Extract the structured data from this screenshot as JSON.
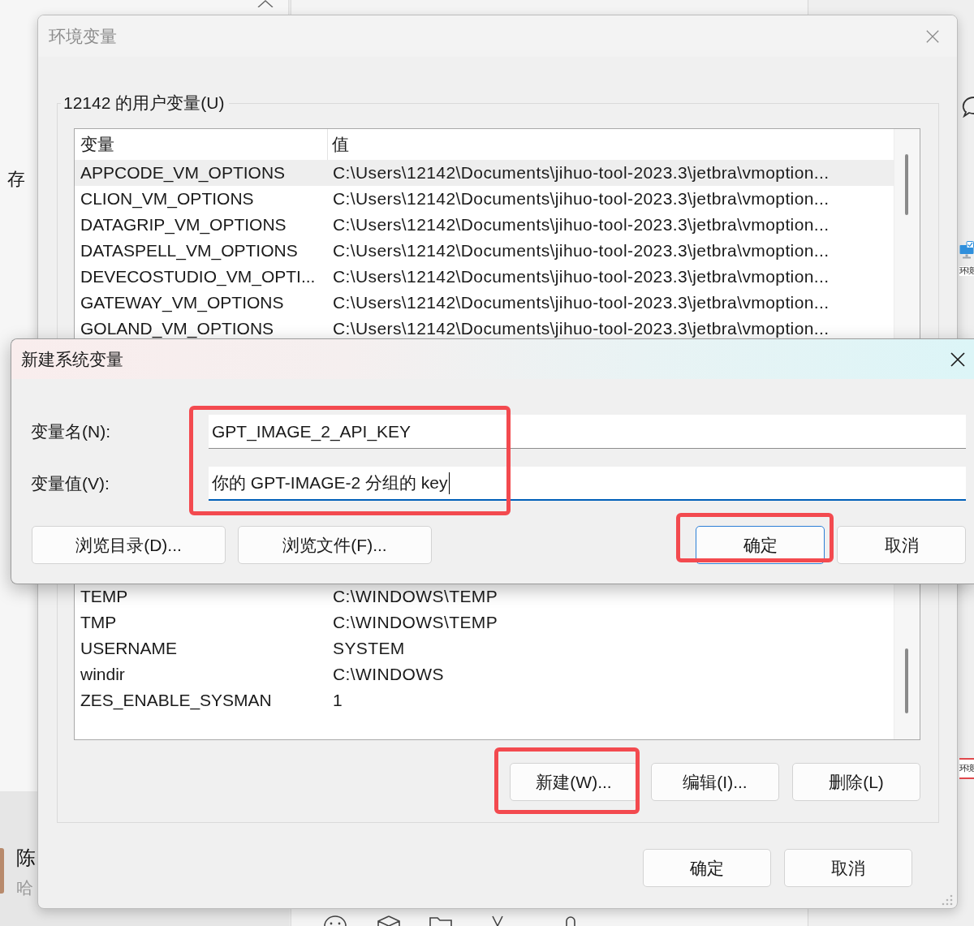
{
  "background": {
    "memory_label": "存",
    "chat_item": {
      "name": "陈",
      "preview": "哈"
    },
    "side_labels": [
      {
        "text": "环境",
        "kind": "caption"
      },
      {
        "text": "环境",
        "kind": "tag"
      }
    ]
  },
  "env_dialog": {
    "title": "环境变量",
    "active": false,
    "user_group": {
      "title": "12142 的用户变量(U)",
      "columns": [
        "变量",
        "值"
      ],
      "rows": [
        {
          "name": "APPCODE_VM_OPTIONS",
          "value": "C:\\Users\\12142\\Documents\\jihuo-tool-2023.3\\jetbra\\vmoption...",
          "selected": true
        },
        {
          "name": "CLION_VM_OPTIONS",
          "value": "C:\\Users\\12142\\Documents\\jihuo-tool-2023.3\\jetbra\\vmoption...",
          "selected": false
        },
        {
          "name": "DATAGRIP_VM_OPTIONS",
          "value": "C:\\Users\\12142\\Documents\\jihuo-tool-2023.3\\jetbra\\vmoption...",
          "selected": false
        },
        {
          "name": "DATASPELL_VM_OPTIONS",
          "value": "C:\\Users\\12142\\Documents\\jihuo-tool-2023.3\\jetbra\\vmoption...",
          "selected": false
        },
        {
          "name": "DEVECOSTUDIO_VM_OPTI...",
          "value": "C:\\Users\\12142\\Documents\\jihuo-tool-2023.3\\jetbra\\vmoption...",
          "selected": false
        },
        {
          "name": "GATEWAY_VM_OPTIONS",
          "value": "C:\\Users\\12142\\Documents\\jihuo-tool-2023.3\\jetbra\\vmoption...",
          "selected": false
        },
        {
          "name": "GOLAND_VM_OPTIONS",
          "value": "C:\\Users\\12142\\Documents\\jihuo-tool-2023.3\\jetbra\\vmoption...",
          "selected": false
        }
      ]
    },
    "system_group": {
      "rows": [
        {
          "name": "TEMP",
          "value": "C:\\WINDOWS\\TEMP",
          "selected": false
        },
        {
          "name": "TMP",
          "value": "C:\\WINDOWS\\TEMP",
          "selected": false
        },
        {
          "name": "USERNAME",
          "value": "SYSTEM",
          "selected": false
        },
        {
          "name": "windir",
          "value": "C:\\WINDOWS",
          "selected": false
        },
        {
          "name": "ZES_ENABLE_SYSMAN",
          "value": "1",
          "selected": false
        }
      ],
      "buttons": [
        {
          "label": "新建(W)...",
          "highlighted": true
        },
        {
          "label": "编辑(I)...",
          "highlighted": false
        },
        {
          "label": "删除(L)",
          "highlighted": false
        }
      ]
    },
    "buttons": [
      {
        "label": "确定"
      },
      {
        "label": "取消"
      }
    ]
  },
  "new_dialog": {
    "title": "新建系统变量",
    "active": true,
    "fields_highlighted": true,
    "fields": [
      {
        "label": "变量名(N):",
        "value": "GPT_IMAGE_2_API_KEY",
        "focused": false
      },
      {
        "label": "变量值(V):",
        "value": "你的 GPT-IMAGE-2 分组的 key",
        "focused": true
      }
    ],
    "buttons": [
      {
        "label": "浏览目录(D)...",
        "default": false,
        "highlighted": false
      },
      {
        "label": "浏览文件(F)...",
        "default": false,
        "highlighted": false
      },
      {
        "label": "确定",
        "default": true,
        "highlighted": true
      },
      {
        "label": "取消",
        "default": false,
        "highlighted": false
      }
    ]
  }
}
